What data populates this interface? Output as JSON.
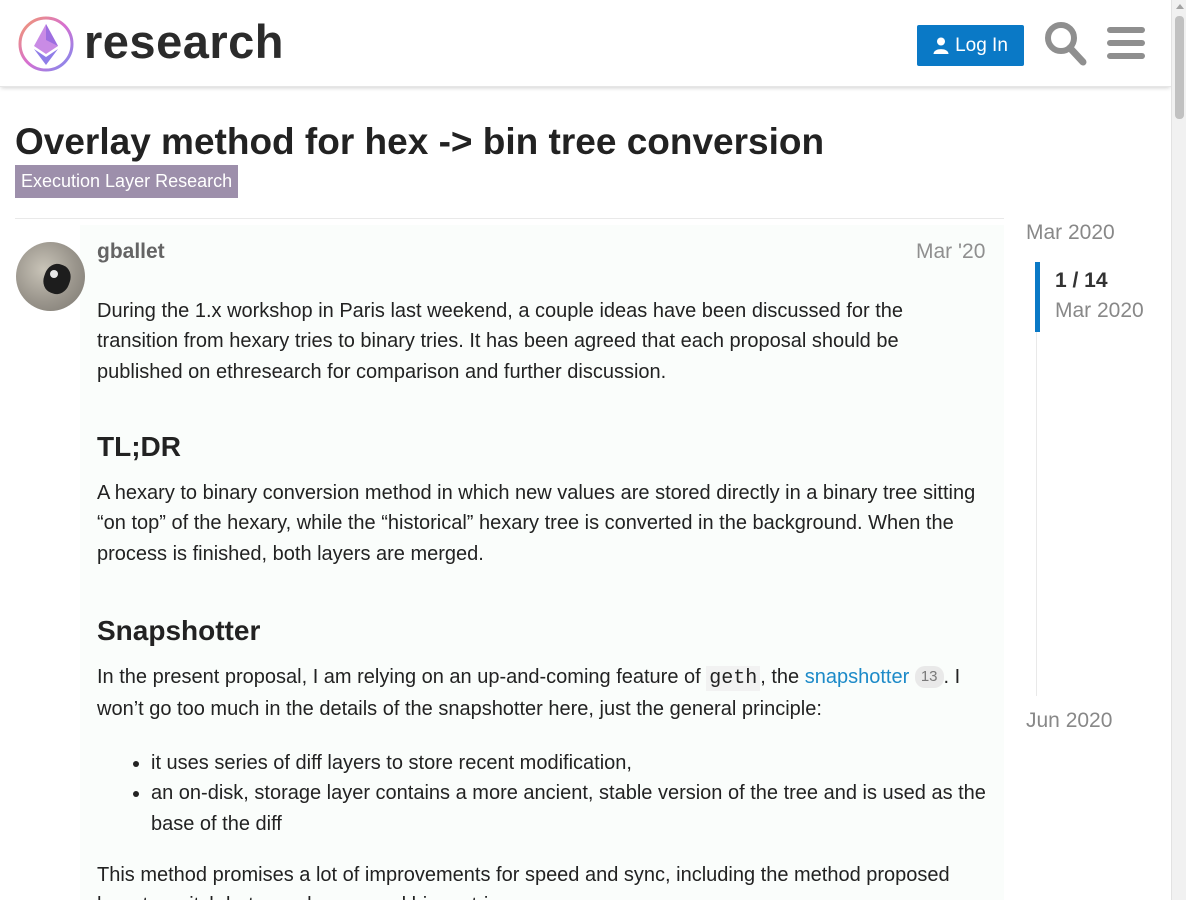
{
  "header": {
    "logo_text": "research",
    "login_label": "Log In",
    "icons": [
      "logo-icon",
      "user-icon",
      "search-icon",
      "hamburger-menu-icon"
    ]
  },
  "topic": {
    "title": "Overlay method for hex -> bin tree conversion",
    "category": "Execution Layer Research",
    "category_color": "#9d8fab"
  },
  "post": {
    "author": "gballet",
    "date": "Mar '20",
    "p1": "During the 1.x workshop in Paris last weekend, a couple ideas have been discussed for the transition from hexary tries to binary tries. It has been agreed that each proposal should be published on ethresearch for comparison and further discussion.",
    "h_tldr": "TL;DR",
    "p2": "A hexary to binary conversion method in which new values are stored directly in a binary tree sitting “on top” of the hexary, while the “historical” hexary tree is converted in the background. When the process is finished, both layers are merged.",
    "h_snapshotter": "Snapshotter",
    "p3_a": "In the present proposal, I am relying on an up-and-coming feature of ",
    "p3_code": "geth",
    "p3_b": ", the ",
    "p3_link": "snapshotter",
    "p3_badge": "13",
    "p3_c": ". I won’t go too much in the details of the snapshotter here, just the general principle:",
    "list": [
      "it uses series of diff layers to store recent modification,",
      "an on-disk, storage layer contains a more ancient, stable version of the tree and is used as the base of the diff"
    ],
    "p4": "This method promises a lot of improvements for speed and sync, including the method proposed here to switch between hexary and binary tries."
  },
  "timeline": {
    "top_date": "Mar 2020",
    "position": "1 / 14",
    "current_date": "Mar 2020",
    "bottom_date": "Jun 2020"
  },
  "colors": {
    "accent": "#0a79c6",
    "link": "#1c8ac8"
  }
}
